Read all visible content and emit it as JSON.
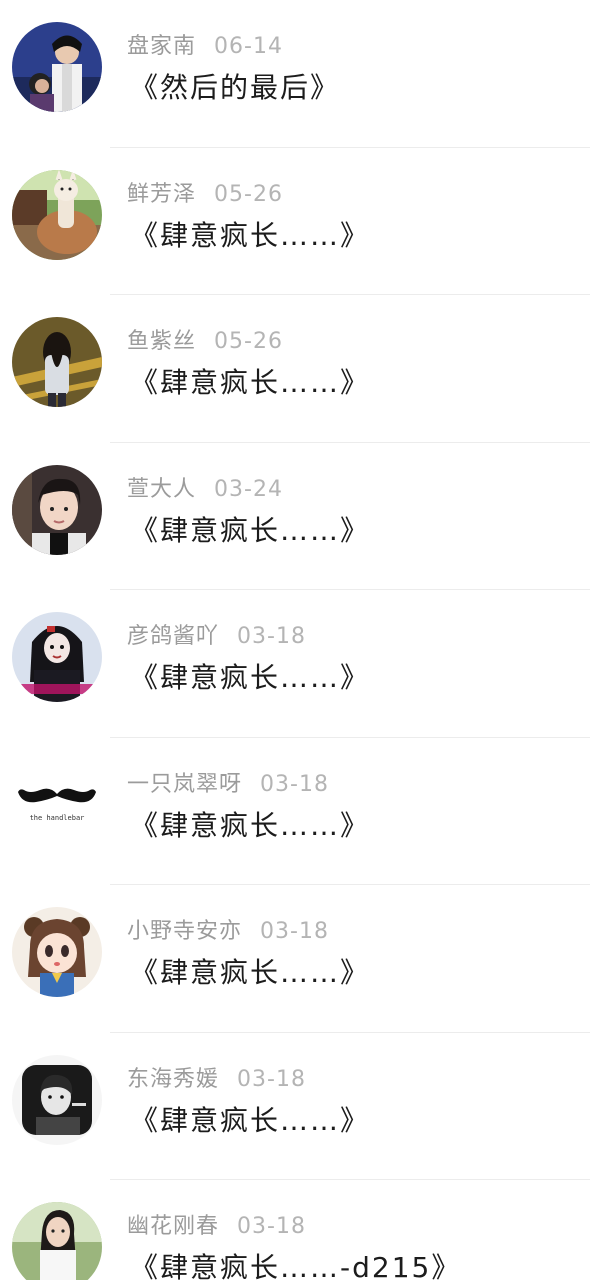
{
  "items": [
    {
      "name": "盘家南",
      "date": "06-14",
      "title": "《然后的最后》",
      "avatar": "avatar-drama-costume-photo"
    },
    {
      "name": "鲜芳泽",
      "date": "05-26",
      "title": "《肆意疯长……》",
      "avatar": "avatar-alpaca-photo"
    },
    {
      "name": "鱼紫丝",
      "date": "05-26",
      "title": "《肆意疯长……》",
      "avatar": "avatar-girl-back-photo"
    },
    {
      "name": "萱大人",
      "date": "03-24",
      "title": "《肆意疯长……》",
      "avatar": "avatar-portrait-photo"
    },
    {
      "name": "彦鸽酱吖",
      "date": "03-18",
      "title": "《肆意疯长……》",
      "avatar": "avatar-gothic-girl-photo"
    },
    {
      "name": "一只岚翠呀",
      "date": "03-18",
      "title": "《肆意疯长……》",
      "avatar": "avatar-mustache-logo",
      "avatar_text": "the handlebar"
    },
    {
      "name": "小野寺安亦",
      "date": "03-18",
      "title": "《肆意疯长……》",
      "avatar": "avatar-anime-girl"
    },
    {
      "name": "东海秀媛",
      "date": "03-18",
      "title": "《肆意疯长……》",
      "avatar": "avatar-bw-portrait-photo"
    },
    {
      "name": "幽花刚春",
      "date": "03-18",
      "title": "《肆意疯长……-d215》",
      "avatar": "avatar-woman-outdoor-photo"
    }
  ]
}
